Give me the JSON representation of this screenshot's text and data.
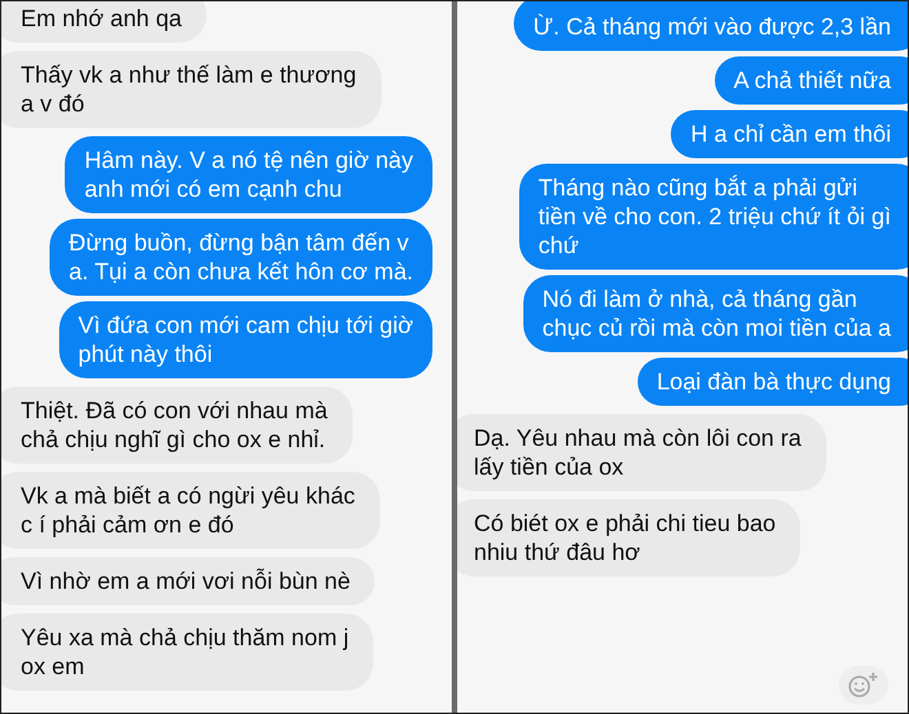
{
  "panels": [
    {
      "messages": [
        {
          "kind": "received",
          "text": "Em nhớ anh qa"
        },
        {
          "kind": "received",
          "text": "Thấy vk a như thế làm e thương\na v đó"
        },
        {
          "kind": "sent",
          "text": "Hâm này. V a nó tệ nên giờ này\nanh mới có em cạnh chu"
        },
        {
          "kind": "sent",
          "text": "Đừng buồn, đừng bận tâm đến v\na. Tụi a còn chưa kết hôn cơ mà."
        },
        {
          "kind": "sent",
          "text": "Vì đứa con mới cam chịu tới giờ\nphút này thôi"
        },
        {
          "kind": "received",
          "text": "Thiệt. Đã có con với nhau mà\nchả chịu nghĩ gì cho ox e nhỉ."
        },
        {
          "kind": "received",
          "text": "Vk a mà biết a có ngừi yêu khác\nc í phải cảm ơn e đó"
        },
        {
          "kind": "received",
          "text": "Vì nhờ em a mới vơi nỗi bùn nè"
        },
        {
          "kind": "received",
          "text": "Yêu xa mà chả chịu thăm nom j\nox em"
        }
      ]
    },
    {
      "messages": [
        {
          "kind": "sent",
          "text": "Ừ. Cả tháng mới vào được 2,3 lần"
        },
        {
          "kind": "sent",
          "text": "A chả thiết nữa"
        },
        {
          "kind": "sent",
          "text": "H a chỉ cần em thôi"
        },
        {
          "kind": "sent",
          "text": "Tháng nào cũng bắt a phải gửi\ntiền về cho con. 2 triệu chứ ít ỏi gì\nchứ"
        },
        {
          "kind": "sent",
          "text": "Nó đi làm ở nhà, cả tháng gần\nchục củ rồi mà còn moi tiền của a"
        },
        {
          "kind": "sent",
          "text": "Loại đàn bà thực dụng"
        },
        {
          "kind": "received",
          "text": "Dạ. Yêu nhau mà còn lôi con ra\nlấy tiền của ox"
        },
        {
          "kind": "received",
          "text": "Có biét ox e phải chi tieu bao\nnhiu thứ đâu hơ"
        }
      ]
    }
  ]
}
